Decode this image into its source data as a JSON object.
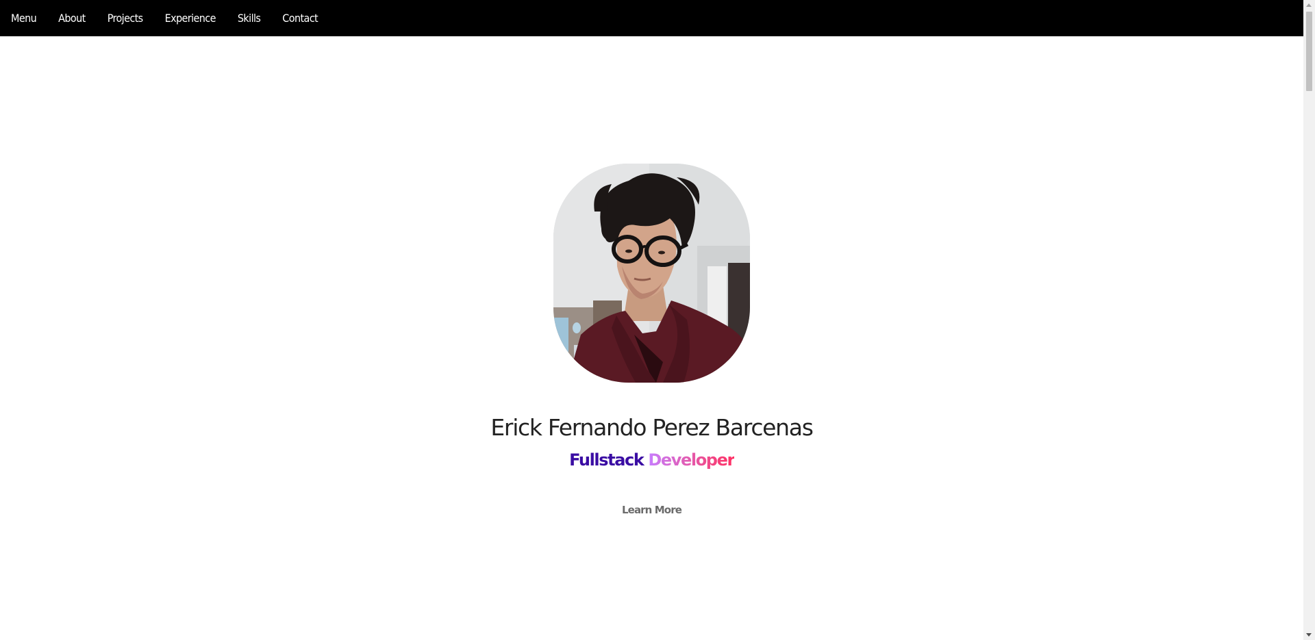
{
  "nav": {
    "items": [
      {
        "label": "Menu"
      },
      {
        "label": "About"
      },
      {
        "label": "Projects"
      },
      {
        "label": "Experience"
      },
      {
        "label": "Skills"
      },
      {
        "label": "Contact"
      }
    ]
  },
  "hero": {
    "avatar_icon": "profile-photo",
    "name": "Erick Fernando Perez Barcenas",
    "role_part1": "Fullstack",
    "role_part2": "Developer",
    "learn_more_label": "Learn More"
  },
  "colors": {
    "navbar_bg": "#000000",
    "role_primary": "#3a0ca3",
    "role_gradient_start": "#c77dff",
    "role_gradient_end": "#ff2e63"
  }
}
